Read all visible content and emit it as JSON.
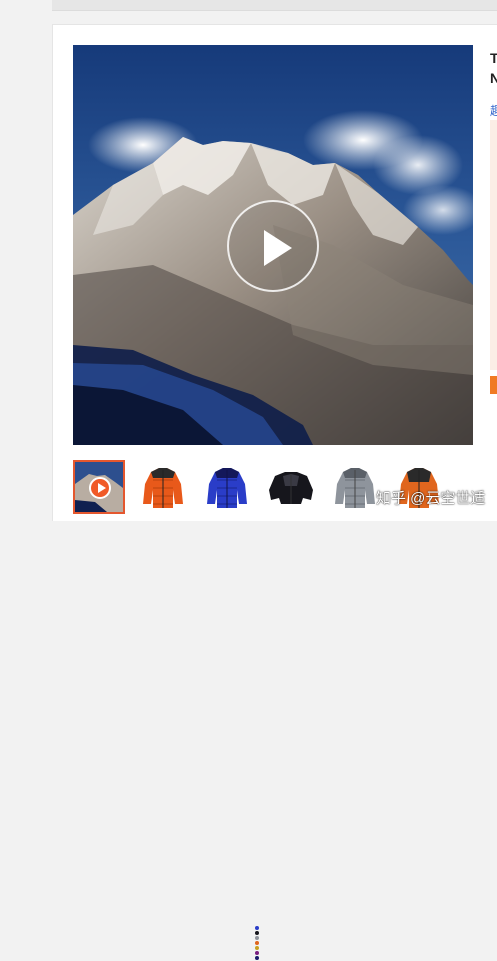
{
  "product": {
    "title_fragment": "T",
    "title_fragment_2": "N",
    "link_fragment": "趣"
  },
  "media": {
    "main_image": "mountain-video-cover",
    "has_video": true
  },
  "thumbnails": [
    {
      "name": "thumb-video-mountain",
      "kind": "video",
      "active": true
    },
    {
      "name": "thumb-orange-puffer-jacket",
      "kind": "image",
      "color": "#e8591a"
    },
    {
      "name": "thumb-blue-puffer-jacket",
      "kind": "image",
      "color": "#2a3dc8"
    },
    {
      "name": "thumb-black-puffer-jacket",
      "kind": "image",
      "color": "#16161c"
    },
    {
      "name": "thumb-grey-puffer-jacket",
      "kind": "image",
      "color": "#8e949c"
    },
    {
      "name": "thumb-orange-puffer-jacket-2",
      "kind": "image",
      "color": "#e0661e"
    }
  ],
  "watermark": {
    "text": "知乎 @云空世适"
  },
  "colors": {
    "accent": "#e4572e",
    "link": "#3366cc"
  }
}
